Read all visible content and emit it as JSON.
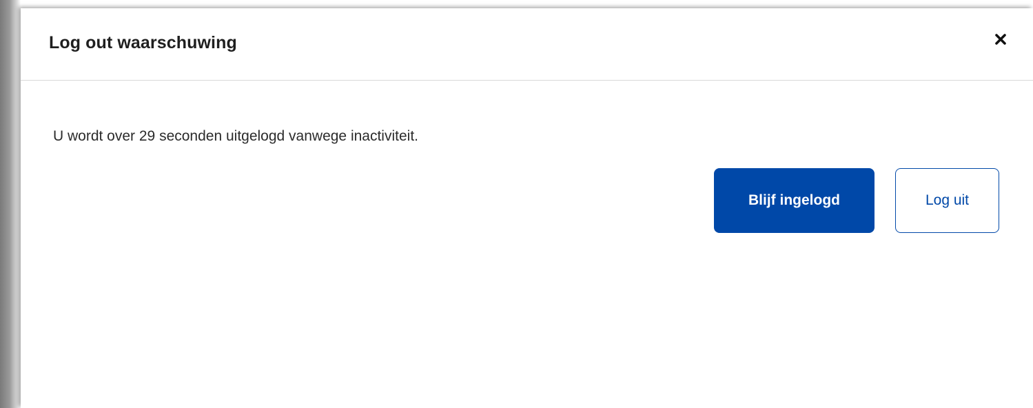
{
  "dialog": {
    "title": "Log out waarschuwing",
    "close_icon": "close-icon",
    "message": "U wordt over 29 seconden uitgelogd vanwege inactiviteit.",
    "stay_logged_in_label": "Blijf ingelogd",
    "log_out_label": "Log uit"
  },
  "colors": {
    "primary": "#0048a8",
    "text": "#1f1f1f",
    "divider": "#d9d9d9"
  }
}
